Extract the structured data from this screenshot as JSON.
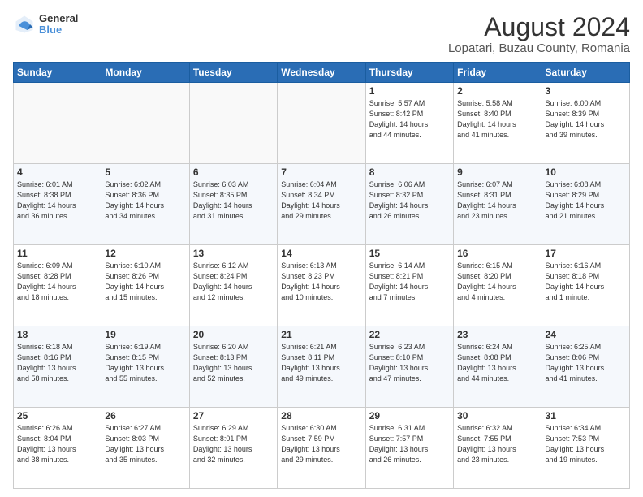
{
  "header": {
    "logo_general": "General",
    "logo_blue": "Blue",
    "title": "August 2024",
    "subtitle": "Lopatari, Buzau County, Romania"
  },
  "weekdays": [
    "Sunday",
    "Monday",
    "Tuesday",
    "Wednesday",
    "Thursday",
    "Friday",
    "Saturday"
  ],
  "weeks": [
    [
      {
        "day": "",
        "info": ""
      },
      {
        "day": "",
        "info": ""
      },
      {
        "day": "",
        "info": ""
      },
      {
        "day": "",
        "info": ""
      },
      {
        "day": "1",
        "info": "Sunrise: 5:57 AM\nSunset: 8:42 PM\nDaylight: 14 hours\nand 44 minutes."
      },
      {
        "day": "2",
        "info": "Sunrise: 5:58 AM\nSunset: 8:40 PM\nDaylight: 14 hours\nand 41 minutes."
      },
      {
        "day": "3",
        "info": "Sunrise: 6:00 AM\nSunset: 8:39 PM\nDaylight: 14 hours\nand 39 minutes."
      }
    ],
    [
      {
        "day": "4",
        "info": "Sunrise: 6:01 AM\nSunset: 8:38 PM\nDaylight: 14 hours\nand 36 minutes."
      },
      {
        "day": "5",
        "info": "Sunrise: 6:02 AM\nSunset: 8:36 PM\nDaylight: 14 hours\nand 34 minutes."
      },
      {
        "day": "6",
        "info": "Sunrise: 6:03 AM\nSunset: 8:35 PM\nDaylight: 14 hours\nand 31 minutes."
      },
      {
        "day": "7",
        "info": "Sunrise: 6:04 AM\nSunset: 8:34 PM\nDaylight: 14 hours\nand 29 minutes."
      },
      {
        "day": "8",
        "info": "Sunrise: 6:06 AM\nSunset: 8:32 PM\nDaylight: 14 hours\nand 26 minutes."
      },
      {
        "day": "9",
        "info": "Sunrise: 6:07 AM\nSunset: 8:31 PM\nDaylight: 14 hours\nand 23 minutes."
      },
      {
        "day": "10",
        "info": "Sunrise: 6:08 AM\nSunset: 8:29 PM\nDaylight: 14 hours\nand 21 minutes."
      }
    ],
    [
      {
        "day": "11",
        "info": "Sunrise: 6:09 AM\nSunset: 8:28 PM\nDaylight: 14 hours\nand 18 minutes."
      },
      {
        "day": "12",
        "info": "Sunrise: 6:10 AM\nSunset: 8:26 PM\nDaylight: 14 hours\nand 15 minutes."
      },
      {
        "day": "13",
        "info": "Sunrise: 6:12 AM\nSunset: 8:24 PM\nDaylight: 14 hours\nand 12 minutes."
      },
      {
        "day": "14",
        "info": "Sunrise: 6:13 AM\nSunset: 8:23 PM\nDaylight: 14 hours\nand 10 minutes."
      },
      {
        "day": "15",
        "info": "Sunrise: 6:14 AM\nSunset: 8:21 PM\nDaylight: 14 hours\nand 7 minutes."
      },
      {
        "day": "16",
        "info": "Sunrise: 6:15 AM\nSunset: 8:20 PM\nDaylight: 14 hours\nand 4 minutes."
      },
      {
        "day": "17",
        "info": "Sunrise: 6:16 AM\nSunset: 8:18 PM\nDaylight: 14 hours\nand 1 minute."
      }
    ],
    [
      {
        "day": "18",
        "info": "Sunrise: 6:18 AM\nSunset: 8:16 PM\nDaylight: 13 hours\nand 58 minutes."
      },
      {
        "day": "19",
        "info": "Sunrise: 6:19 AM\nSunset: 8:15 PM\nDaylight: 13 hours\nand 55 minutes."
      },
      {
        "day": "20",
        "info": "Sunrise: 6:20 AM\nSunset: 8:13 PM\nDaylight: 13 hours\nand 52 minutes."
      },
      {
        "day": "21",
        "info": "Sunrise: 6:21 AM\nSunset: 8:11 PM\nDaylight: 13 hours\nand 49 minutes."
      },
      {
        "day": "22",
        "info": "Sunrise: 6:23 AM\nSunset: 8:10 PM\nDaylight: 13 hours\nand 47 minutes."
      },
      {
        "day": "23",
        "info": "Sunrise: 6:24 AM\nSunset: 8:08 PM\nDaylight: 13 hours\nand 44 minutes."
      },
      {
        "day": "24",
        "info": "Sunrise: 6:25 AM\nSunset: 8:06 PM\nDaylight: 13 hours\nand 41 minutes."
      }
    ],
    [
      {
        "day": "25",
        "info": "Sunrise: 6:26 AM\nSunset: 8:04 PM\nDaylight: 13 hours\nand 38 minutes."
      },
      {
        "day": "26",
        "info": "Sunrise: 6:27 AM\nSunset: 8:03 PM\nDaylight: 13 hours\nand 35 minutes."
      },
      {
        "day": "27",
        "info": "Sunrise: 6:29 AM\nSunset: 8:01 PM\nDaylight: 13 hours\nand 32 minutes."
      },
      {
        "day": "28",
        "info": "Sunrise: 6:30 AM\nSunset: 7:59 PM\nDaylight: 13 hours\nand 29 minutes."
      },
      {
        "day": "29",
        "info": "Sunrise: 6:31 AM\nSunset: 7:57 PM\nDaylight: 13 hours\nand 26 minutes."
      },
      {
        "day": "30",
        "info": "Sunrise: 6:32 AM\nSunset: 7:55 PM\nDaylight: 13 hours\nand 23 minutes."
      },
      {
        "day": "31",
        "info": "Sunrise: 6:34 AM\nSunset: 7:53 PM\nDaylight: 13 hours\nand 19 minutes."
      }
    ]
  ]
}
